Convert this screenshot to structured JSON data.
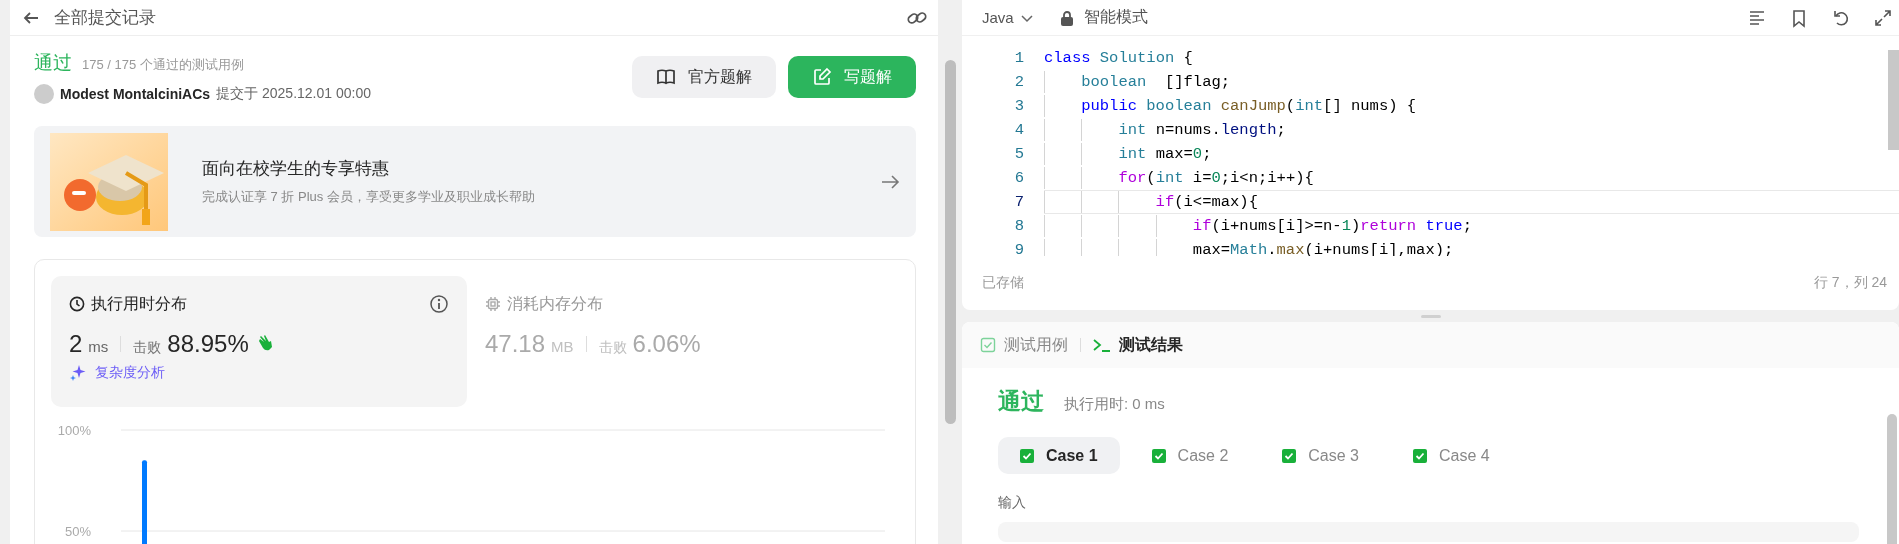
{
  "submission_panel": {
    "header": {
      "title": "全部提交记录"
    },
    "summary": {
      "status": "通过",
      "tests": "175 / 175 个通过的测试用例",
      "user": "Modest MontalciniACs",
      "submitted": "提交于 2025.12.01 00:00",
      "buttons": [
        {
          "label": "官方题解",
          "kind": "secondary"
        },
        {
          "label": "写题解",
          "kind": "primary"
        }
      ]
    },
    "promo": {
      "title": "面向在校学生的专享特惠",
      "subtitle": "完成认证享 7 折 Plus 会员，享受更多学业及职业成长帮助"
    },
    "stats": {
      "tabs": [
        {
          "title": "执行用时分布",
          "kind": "time",
          "selected": true,
          "value": "2",
          "unit": "ms",
          "beats_label": "击败",
          "beats": "88.95%"
        },
        {
          "title": "消耗内存分布",
          "kind": "memory",
          "selected": false,
          "value": "47.18",
          "unit": "MB",
          "beats_label": "击败",
          "beats": "6.06%"
        }
      ],
      "analysis_link": "复杂度分析",
      "chart_data": {
        "type": "bar",
        "ylim": [
          0,
          100
        ],
        "yticks": [
          {
            "value": 50,
            "label": "50%"
          },
          {
            "value": 100,
            "label": "100%"
          }
        ],
        "series": [
          {
            "color": "#007aff",
            "values": [
              85
            ]
          }
        ]
      }
    }
  },
  "editor": {
    "language": "Java",
    "mode": "智能模式",
    "lines": [
      {
        "number": "1",
        "current": false,
        "tokens": [
          {
            "text": "class",
            "kind": "keyword"
          },
          {
            "text": " Solution",
            "kind": "type"
          },
          {
            "text": " {",
            "kind": "plain"
          }
        ]
      },
      {
        "number": "2",
        "current": false,
        "tokens": [
          {
            "text": "    boolean",
            "kind": "type"
          },
          {
            "text": "  []flag;",
            "kind": "plain"
          }
        ]
      },
      {
        "number": "3",
        "current": false,
        "tokens": [
          {
            "text": "    public",
            "kind": "keyword"
          },
          {
            "text": " boolean",
            "kind": "type"
          },
          {
            "text": " canJump",
            "kind": "function"
          },
          {
            "text": "(",
            "kind": "plain"
          },
          {
            "text": "int",
            "kind": "type"
          },
          {
            "text": "[] nums) {",
            "kind": "plain"
          }
        ]
      },
      {
        "number": "4",
        "current": false,
        "tokens": [
          {
            "text": "        int",
            "kind": "type"
          },
          {
            "text": " n=nums.",
            "kind": "plain"
          },
          {
            "text": "length",
            "kind": "property"
          },
          {
            "text": ";",
            "kind": "plain"
          }
        ]
      },
      {
        "number": "5",
        "current": false,
        "tokens": [
          {
            "text": "        int",
            "kind": "type"
          },
          {
            "text": " max=",
            "kind": "plain"
          },
          {
            "text": "0",
            "kind": "number"
          },
          {
            "text": ";",
            "kind": "plain"
          }
        ]
      },
      {
        "number": "6",
        "current": false,
        "tokens": [
          {
            "text": "        for",
            "kind": "control"
          },
          {
            "text": "(",
            "kind": "plain"
          },
          {
            "text": "int",
            "kind": "type"
          },
          {
            "text": " i=",
            "kind": "plain"
          },
          {
            "text": "0",
            "kind": "number"
          },
          {
            "text": ";i<n;i++){",
            "kind": "plain"
          }
        ]
      },
      {
        "number": "7",
        "current": true,
        "tokens": [
          {
            "text": "            if",
            "kind": "control"
          },
          {
            "text": "(i<=max){",
            "kind": "plain"
          }
        ]
      },
      {
        "number": "8",
        "current": false,
        "tokens": [
          {
            "text": "                if",
            "kind": "control"
          },
          {
            "text": "(i+nums[i]>=n-",
            "kind": "plain"
          },
          {
            "text": "1",
            "kind": "number"
          },
          {
            "text": ")",
            "kind": "plain"
          },
          {
            "text": "return",
            "kind": "control"
          },
          {
            "text": " true",
            "kind": "keyword"
          },
          {
            "text": ";",
            "kind": "plain"
          }
        ]
      },
      {
        "number": "9",
        "current": false,
        "tokens": [
          {
            "text": "                max=",
            "kind": "plain"
          },
          {
            "text": "Math",
            "kind": "type"
          },
          {
            "text": ".",
            "kind": "plain"
          },
          {
            "text": "max",
            "kind": "function"
          },
          {
            "text": "(i+nums[i],max);",
            "kind": "plain"
          }
        ]
      }
    ],
    "saved": "已存储",
    "cursor": "行 7，列 24"
  },
  "test_panel": {
    "tabs": [
      {
        "label": "测试用例",
        "kind": "cases",
        "selected": false
      },
      {
        "label": "测试结果",
        "kind": "result",
        "selected": true
      }
    ],
    "result": "通过",
    "runtime": "执行用时: 0 ms",
    "cases": [
      {
        "label": "Case 1",
        "selected": true,
        "passed": true
      },
      {
        "label": "Case 2",
        "selected": false,
        "passed": true
      },
      {
        "label": "Case 3",
        "selected": false,
        "passed": true
      },
      {
        "label": "Case 4",
        "selected": false,
        "passed": true
      }
    ],
    "input_label": "输入"
  }
}
